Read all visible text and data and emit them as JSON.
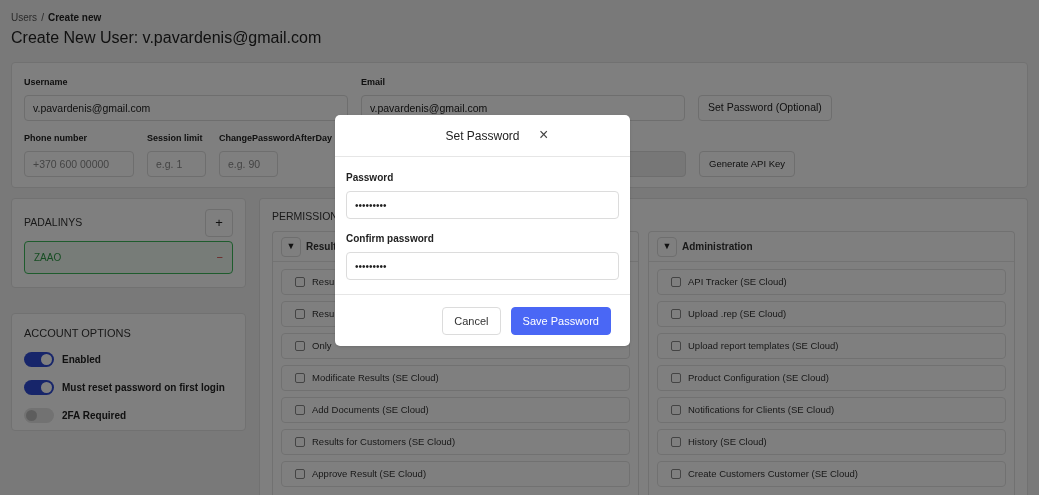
{
  "breadcrumb": {
    "parent": "Users",
    "separator": "/",
    "current": "Create new"
  },
  "title": "Create New User: v.pavardenis@gmail.com",
  "user_form": {
    "row_1": [
      {
        "kind": "field",
        "label": "Username",
        "value": "v.pavardenis@gmail.com"
      },
      {
        "kind": "field",
        "label": "Email",
        "value": "v.pavardenis@gmail.com"
      },
      {
        "kind": "button",
        "label": "Set Password (Optional)"
      }
    ],
    "row_2": [
      {
        "kind": "field",
        "label": "Phone number",
        "placeholder": "+370 600 00000"
      },
      {
        "kind": "field",
        "label": "Session limit",
        "placeholder": "e.g. 1"
      },
      {
        "kind": "field",
        "label": "ChangePasswordAfterDay",
        "placeholder": "e.g. 90"
      },
      {
        "kind": "button",
        "label": "Generate API Key"
      }
    ]
  },
  "departments": {
    "title": "PADALINYS",
    "add_button": "+",
    "items": [
      {
        "name": "ZAAO",
        "remove": "−"
      }
    ]
  },
  "account_options": {
    "title": "ACCOUNT OPTIONS",
    "toggles": [
      {
        "label": "Enabled",
        "on": true
      },
      {
        "label": "Must reset password on first login",
        "on": true
      },
      {
        "label": "2FA Required",
        "on": false
      }
    ]
  },
  "permissions": {
    "title": "PERMISSION",
    "groups": [
      {
        "name": "Result",
        "expanded": true,
        "toggle": "▼",
        "items": [
          {
            "label": "Resu",
            "checked": false
          },
          {
            "label": "Resu",
            "checked": false
          },
          {
            "label": "Only",
            "checked": false
          },
          {
            "label": "Modificate Results (SE Cloud)",
            "checked": false
          },
          {
            "label": "Add Documents (SE Cloud)",
            "checked": false
          },
          {
            "label": "Results for Customers (SE Cloud)",
            "checked": false
          },
          {
            "label": "Approve Result (SE Cloud)",
            "checked": false
          }
        ]
      },
      {
        "name": "Administration",
        "expanded": true,
        "toggle": "▼",
        "items": [
          {
            "label": "API Tracker (SE Cloud)",
            "checked": false
          },
          {
            "label": "Upload .rep (SE Cloud)",
            "checked": false
          },
          {
            "label": "Upload report templates (SE Cloud)",
            "checked": false
          },
          {
            "label": "Product Configuration (SE Cloud)",
            "checked": false
          },
          {
            "label": "Notifications for Clients (SE Cloud)",
            "checked": false
          },
          {
            "label": "History (SE Cloud)",
            "checked": false
          },
          {
            "label": "Create Customers Customer (SE Cloud)",
            "checked": false
          }
        ]
      }
    ]
  },
  "modal": {
    "title": "Set Password",
    "close": "×",
    "fields": [
      {
        "label": "Password",
        "value": "•••••••••"
      },
      {
        "label": "Confirm password",
        "value": "•••••••••"
      }
    ],
    "buttons": [
      {
        "kind": "secondary",
        "label": "Cancel"
      },
      {
        "kind": "primary",
        "label": "Save Password"
      }
    ]
  }
}
